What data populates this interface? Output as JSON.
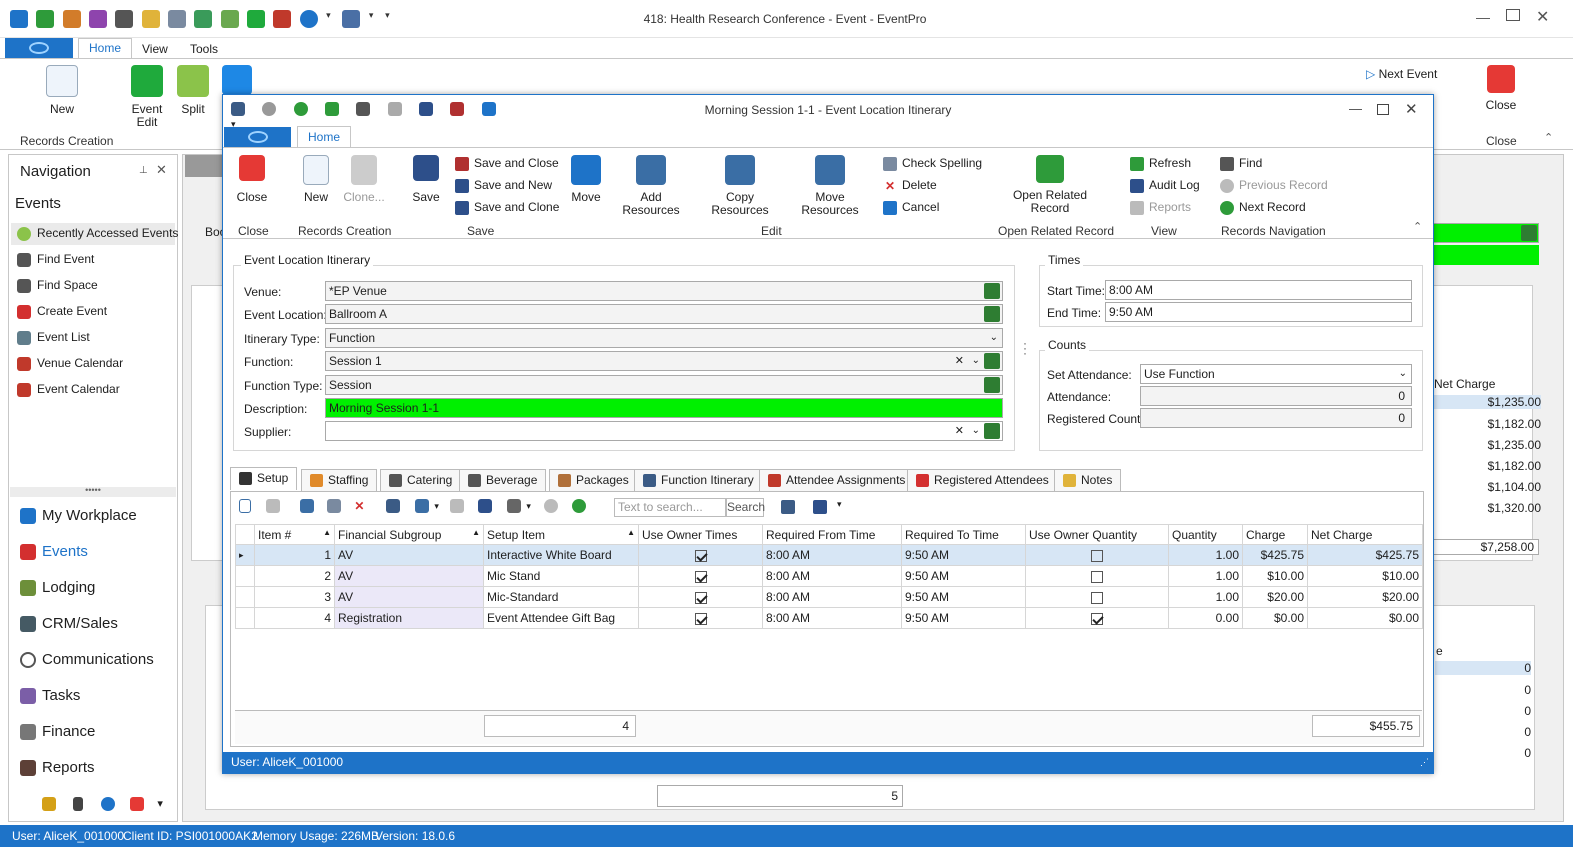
{
  "main_window": {
    "title": "418: Health Research Conference - Event - EventPro",
    "tabs": [
      "Home",
      "View",
      "Tools"
    ],
    "ribbon": {
      "new_label": "New",
      "event_edit_label": "Event\nEdit",
      "split_label": "Split",
      "records_creation_label": "Records Creation",
      "next_event_label": "Next Event",
      "close_label": "Close",
      "close_group_label": "Close"
    },
    "status_bar": {
      "user": "User: AliceK_001000",
      "client_id": "Client ID: PSI001000AK2",
      "memory": "Memory Usage: 226MB",
      "version": "Version: 18.0.6"
    },
    "bg_net_charge_header": "Net Charge",
    "bg_net_charges": [
      "$1,235.00",
      "$1,182.00",
      "$1,235.00",
      "$1,182.00",
      "$1,104.00",
      "$1,320.00"
    ],
    "bg_total": "$7,258.00",
    "bg_zeros": [
      "0",
      "0",
      "0",
      "0",
      "0"
    ],
    "bg_count": "5",
    "bg_partial_tab": "Boo",
    "bg_partial_header": "e"
  },
  "navigation": {
    "title": "Navigation",
    "section": "Events",
    "items": [
      "Recently Accessed Events",
      "Find Event",
      "Find Space",
      "Create Event",
      "Event List",
      "Venue Calendar",
      "Event Calendar"
    ],
    "modules": [
      "My Workplace",
      "Events",
      "Lodging",
      "CRM/Sales",
      "Communications",
      "Tasks",
      "Finance",
      "Reports"
    ]
  },
  "dialog": {
    "title": "Morning Session 1-1 - Event Location Itinerary",
    "tab": "Home",
    "ribbon": {
      "close": "Close",
      "new": "New",
      "clone": "Clone...",
      "save": "Save",
      "save_and_close": "Save and Close",
      "save_and_new": "Save and New",
      "save_and_clone": "Save and Clone",
      "move": "Move",
      "add_resources": "Add Resources",
      "copy_resources": "Copy Resources",
      "move_resources": "Move Resources",
      "check_spelling": "Check Spelling",
      "delete": "Delete",
      "cancel": "Cancel",
      "open_related_record": "Open Related\nRecord",
      "refresh": "Refresh",
      "audit_log": "Audit Log",
      "reports": "Reports",
      "find": "Find",
      "previous_record": "Previous Record",
      "next_record": "Next Record",
      "groups": [
        "Close",
        "Records Creation",
        "Save",
        "Edit",
        "Open Related Record",
        "View",
        "Records Navigation"
      ]
    },
    "itinerary": {
      "section_title": "Event Location Itinerary",
      "venue_label": "Venue:",
      "venue": "*EP Venue",
      "event_location_label": "Event Location:",
      "event_location": "Ballroom A",
      "itinerary_type_label": "Itinerary Type:",
      "itinerary_type": "Function",
      "function_label": "Function:",
      "function": "Session 1",
      "function_type_label": "Function Type:",
      "function_type": "Session",
      "description_label": "Description:",
      "description": "Morning Session 1-1",
      "supplier_label": "Supplier:",
      "supplier": ""
    },
    "times": {
      "section_title": "Times",
      "start_label": "Start Time:",
      "start": "8:00 AM",
      "end_label": "End Time:",
      "end": "9:50 AM"
    },
    "counts": {
      "section_title": "Counts",
      "set_attendance_label": "Set Attendance:",
      "set_attendance": "Use Function",
      "attendance_label": "Attendance:",
      "attendance": "0",
      "registered_label": "Registered Count:",
      "registered": "0"
    },
    "tabs": [
      "Setup",
      "Staffing",
      "Catering",
      "Beverage",
      "Packages",
      "Function Itinerary",
      "Attendee Assignments",
      "Registered Attendees",
      "Notes"
    ],
    "search_placeholder": "Text to search...",
    "search_button": "Search",
    "grid": {
      "columns": [
        "Item #",
        "Financial Subgroup",
        "Setup Item",
        "Use Owner Times",
        "Required From Time",
        "Required To Time",
        "Use Owner Quantity",
        "Quantity",
        "Charge",
        "Net Charge"
      ],
      "rows": [
        {
          "item": "1",
          "subgroup": "AV",
          "setup": "Interactive White Board",
          "owner_times": true,
          "from": "8:00 AM",
          "to": "9:50 AM",
          "owner_qty": false,
          "qty": "1.00",
          "charge": "$425.75",
          "net": "$425.75"
        },
        {
          "item": "2",
          "subgroup": "AV",
          "setup": "Mic Stand",
          "owner_times": true,
          "from": "8:00 AM",
          "to": "9:50 AM",
          "owner_qty": false,
          "qty": "1.00",
          "charge": "$10.00",
          "net": "$10.00"
        },
        {
          "item": "3",
          "subgroup": "AV",
          "setup": "Mic-Standard",
          "owner_times": true,
          "from": "8:00 AM",
          "to": "9:50 AM",
          "owner_qty": false,
          "qty": "1.00",
          "charge": "$20.00",
          "net": "$20.00"
        },
        {
          "item": "4",
          "subgroup": "Registration",
          "setup": "Event Attendee Gift Bag",
          "owner_times": true,
          "from": "8:00 AM",
          "to": "9:50 AM",
          "owner_qty": true,
          "qty": "0.00",
          "charge": "$0.00",
          "net": "$0.00"
        }
      ],
      "count_total": "4",
      "net_total": "$455.75"
    },
    "status_user": "User: AliceK_001000"
  },
  "colors": {
    "accent_blue": "#1e73c8",
    "green_highlight": "#00f000",
    "red_close": "#e53935"
  }
}
